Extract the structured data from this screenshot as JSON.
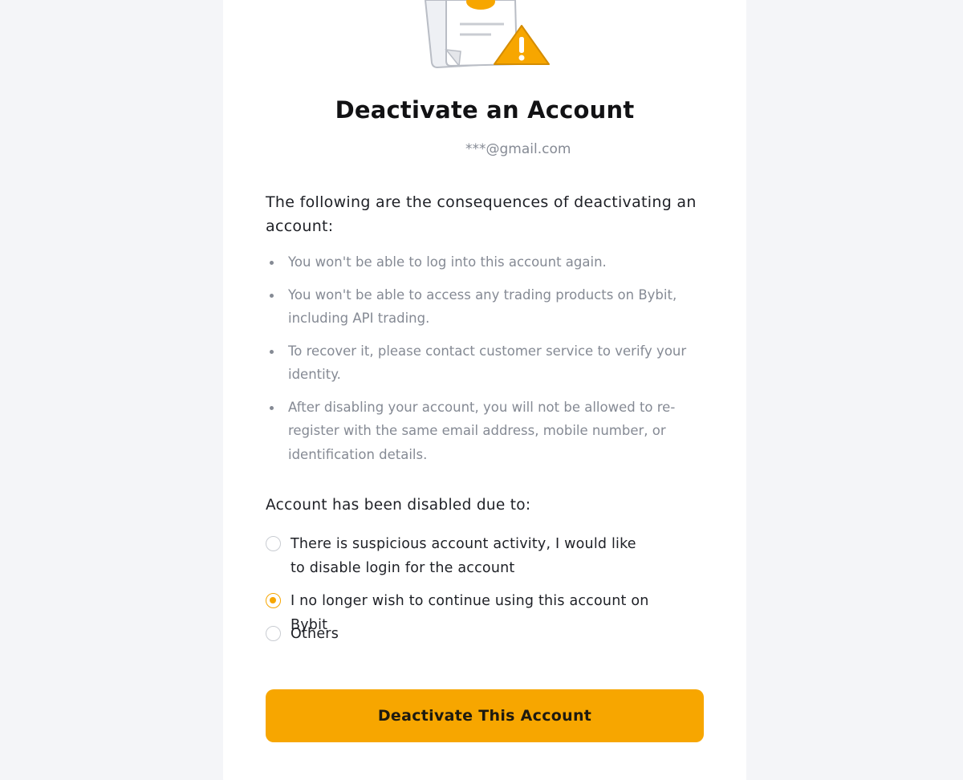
{
  "header": {
    "illustration_icon": "document-warning-icon",
    "title": "Deactivate an Account",
    "email": "***@gmail.com"
  },
  "consequences": {
    "intro": "The following are the consequences of deactivating an account:",
    "items": [
      {
        "text": "You won't be able to log into this account again."
      },
      {
        "text": "You won't be able to access any trading products on Bybit, including API trading."
      },
      {
        "text": "To recover it, please contact customer service to verify your identity."
      },
      {
        "text": "After disabling your account, you will not be allowed to re-register with the same email address, mobile number, or identification details."
      }
    ]
  },
  "reason": {
    "label": "Account has been disabled due to:",
    "options": [
      {
        "label": "There is suspicious account activity, I would like to disable login for the account",
        "selected": false
      },
      {
        "label": "I no longer wish to continue using this account on Bybit",
        "selected": true
      },
      {
        "label": "Others",
        "selected": false
      }
    ]
  },
  "actions": {
    "deactivate_label": "Deactivate This Account"
  },
  "colors": {
    "accent": "#f7a600",
    "background": "#f4f5f8",
    "card": "#ffffff",
    "text_primary": "#1e2026",
    "text_secondary": "#858a94"
  }
}
